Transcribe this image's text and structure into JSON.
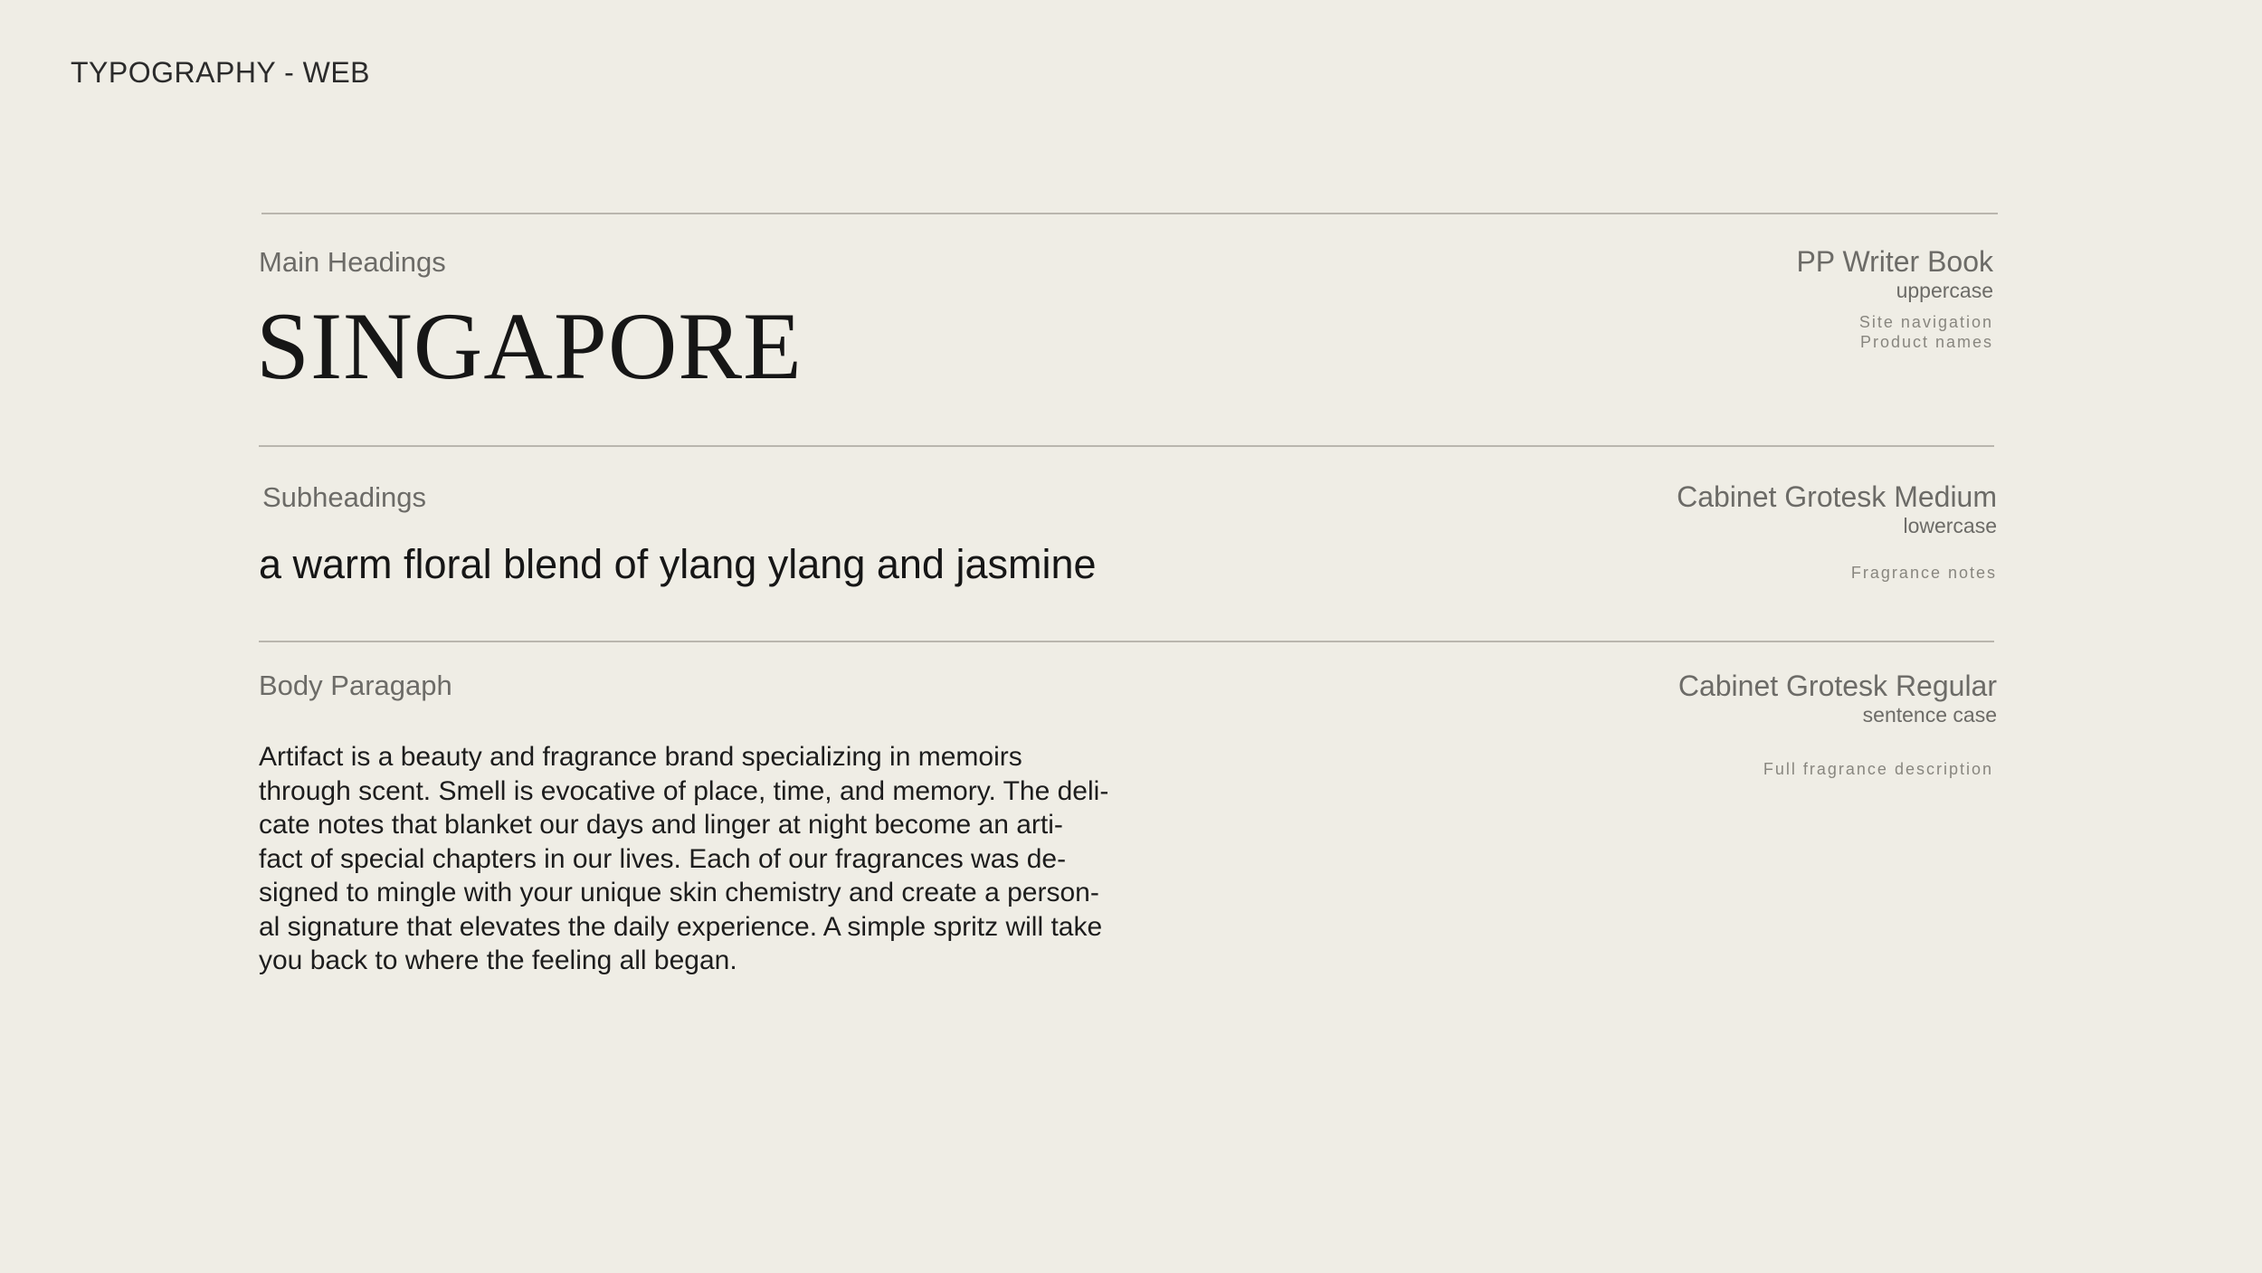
{
  "page": {
    "title": "TYPOGRAPHY - WEB",
    "background": "#efede5"
  },
  "sections": [
    {
      "label": "Main Headings",
      "sample": "SINGAPORE",
      "font": "PP Writer Book",
      "case": "uppercase",
      "usage": [
        "Site navigation",
        "Product names"
      ]
    },
    {
      "label": "Subheadings",
      "sample": "a warm floral blend of ylang ylang and jasmine",
      "font": "Cabinet Grotesk Medium",
      "case": "lowercase",
      "usage": [
        "Fragrance notes"
      ]
    },
    {
      "label": "Body Paragaph",
      "sample": "Artifact is a beauty and fragrance brand specializing in memoirs\nthrough scent. Smell is evocative of place, time, and memory. The deli-\ncate notes that blanket our days and linger at night become an arti-\nfact of special chapters in our lives. Each of our fragrances was de-\nsigned to mingle with your unique skin chemistry and create a person-\nal signature that elevates the daily experience. A simple spritz will take\nyou back to where the feeling all began.",
      "font": "Cabinet Grotesk Regular",
      "case": "sentence case",
      "usage": [
        "Full fragrance description"
      ]
    }
  ],
  "colors": {
    "text_primary": "#161616",
    "text_muted": "#6c6b67",
    "rule": "#b9b6ae"
  }
}
